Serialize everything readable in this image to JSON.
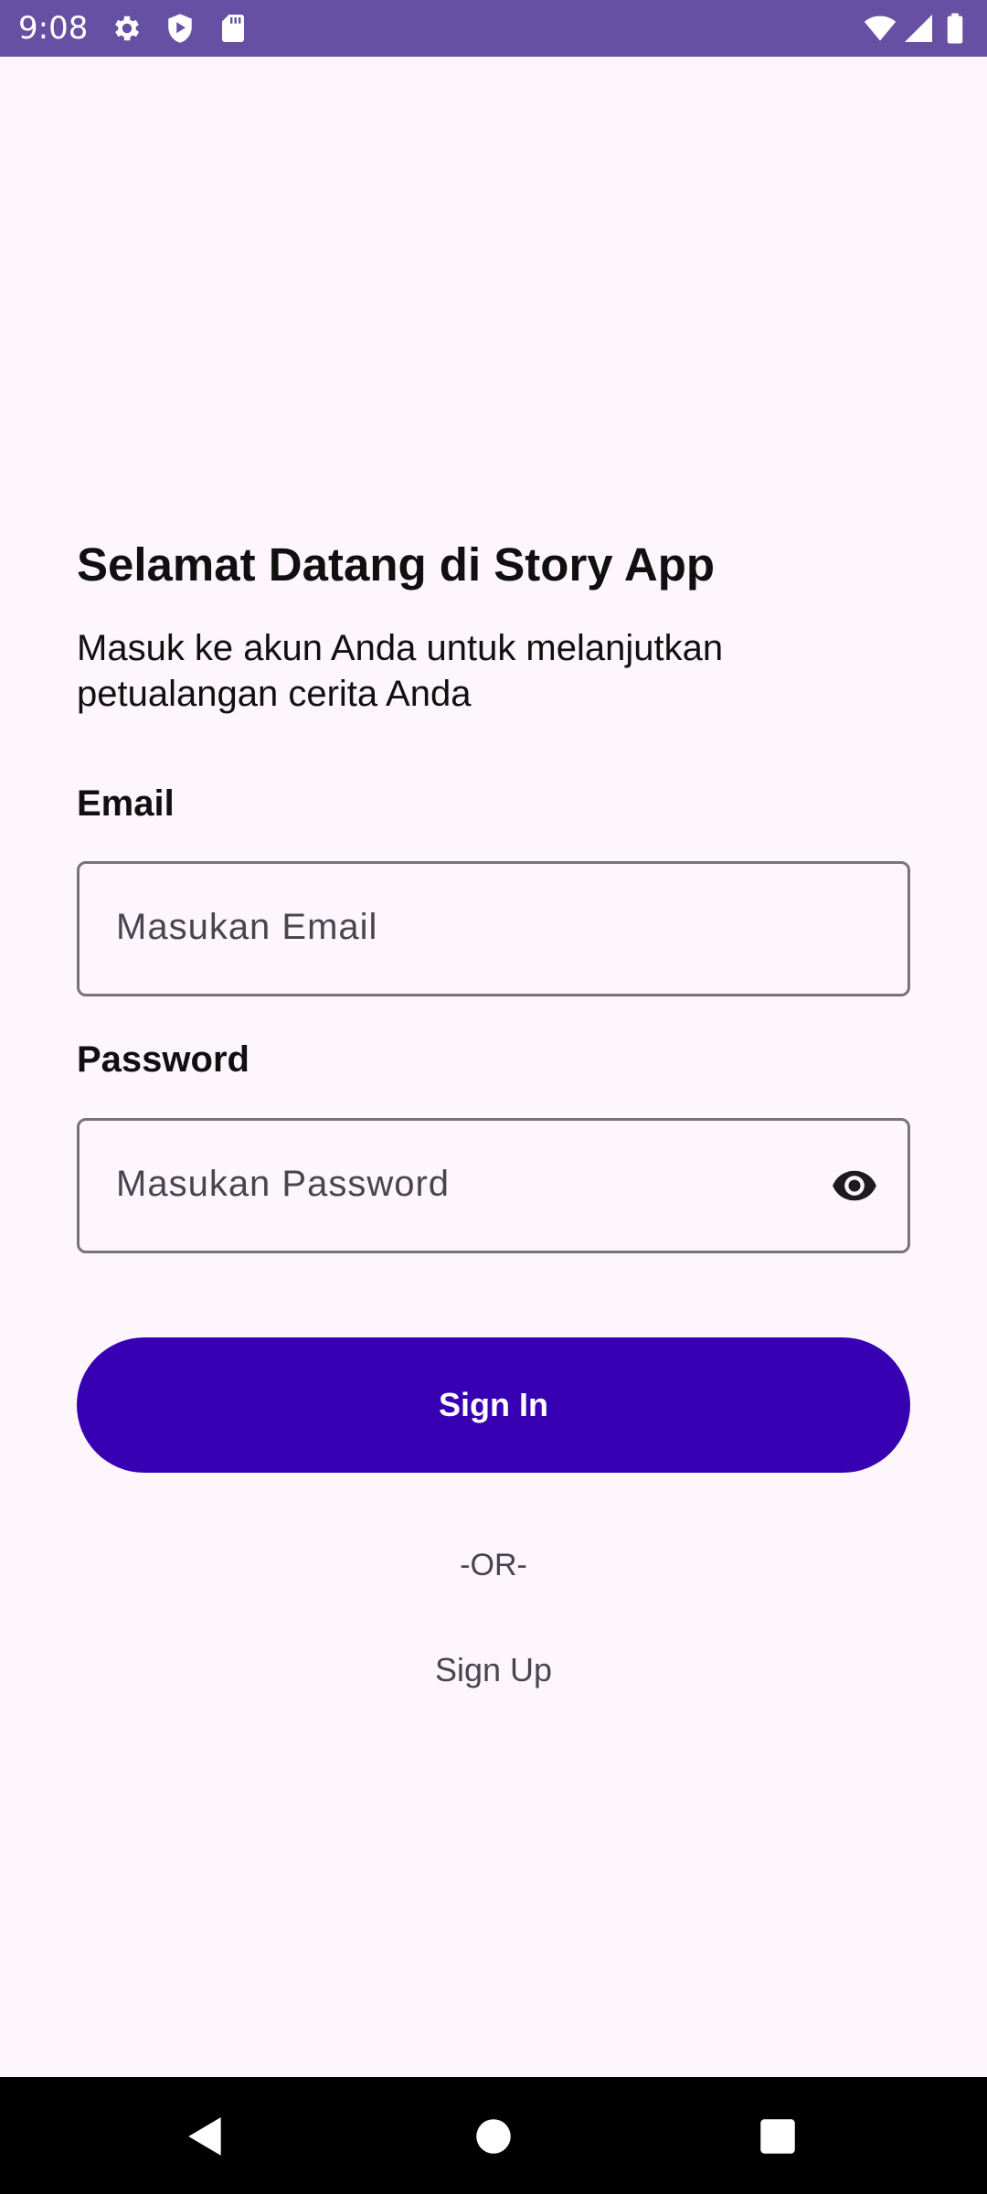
{
  "status_bar": {
    "time": "9:08",
    "left_icons": [
      "gear-icon",
      "shield-play-icon",
      "sd-card-icon"
    ],
    "right_icons": [
      "wifi-icon",
      "signal-icon",
      "battery-icon"
    ],
    "background": "#6650a4"
  },
  "login": {
    "title": "Selamat Datang di Story App",
    "subtitle": "Masuk ke akun Anda untuk melanjutkan petualangan cerita Anda",
    "email_label": "Email",
    "email_placeholder": "Masukan Email",
    "password_label": "Password",
    "password_placeholder": "Masukan Password",
    "sign_in_label": "Sign In",
    "or_divider": "-OR-",
    "sign_up_label": "Sign Up"
  },
  "navigation_bar": {
    "buttons": [
      "back-icon",
      "home-icon",
      "recents-icon"
    ]
  },
  "colors": {
    "primary": "#3700b3",
    "status_bar": "#6650a4",
    "background": "#fdf6fd"
  }
}
